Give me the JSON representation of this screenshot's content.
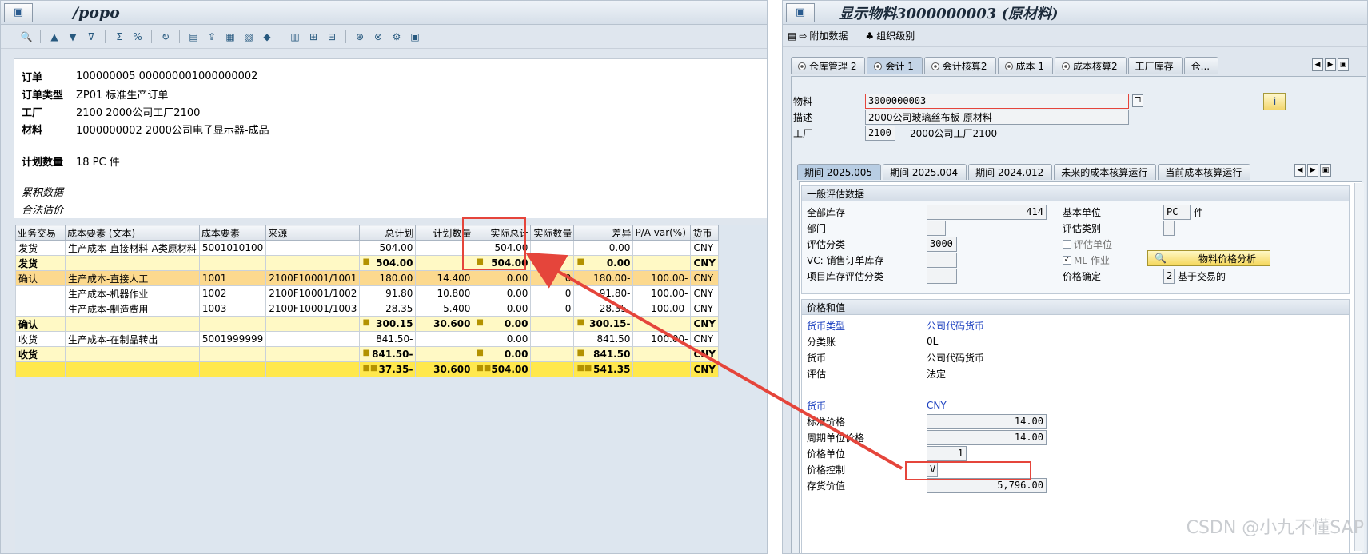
{
  "left": {
    "title": "/popo",
    "header": {
      "rows": [
        {
          "label": "订单",
          "value": "100000005 000000001000000002"
        },
        {
          "label": "订单类型",
          "value": "ZP01 标准生产订单"
        },
        {
          "label": "工厂",
          "value": "2100 2000公司工厂2100"
        },
        {
          "label": "材料",
          "value": "1000000002 2000公司电子显示器-成品"
        }
      ],
      "plan_label": "计划数量",
      "plan_value": "18 PC 件",
      "cum_label": "累积数据",
      "est_label": "合法估价"
    },
    "grid": {
      "columns": [
        "业务交易",
        "成本要素 (文本)",
        "成本要素",
        "来源",
        "总计划",
        "计划数量",
        "实际总计",
        "实际数量",
        "差异",
        "P/A var(%)",
        "货币"
      ],
      "rows": [
        {
          "type": "normal",
          "c": [
            "发货",
            "生产成本-直接材料-A类原材料",
            "5001010100",
            "",
            "504.00",
            "",
            "504.00",
            "",
            "0.00",
            "",
            "CNY"
          ]
        },
        {
          "type": "sub",
          "c": [
            "发货",
            "",
            "",
            "",
            "504.00",
            "",
            "504.00",
            "",
            "0.00",
            "",
            "CNY"
          ]
        },
        {
          "type": "hl",
          "c": [
            "确认",
            "生产成本-直接人工",
            "1001",
            "2100F10001/1001",
            "180.00",
            "14.400",
            "0.00",
            "0",
            "180.00-",
            "100.00-",
            "CNY"
          ]
        },
        {
          "type": "normal",
          "c": [
            "",
            "生产成本-机器作业",
            "1002",
            "2100F10001/1002",
            "91.80",
            "10.800",
            "0.00",
            "0",
            "91.80-",
            "100.00-",
            "CNY"
          ]
        },
        {
          "type": "normal",
          "c": [
            "",
            "生产成本-制造费用",
            "1003",
            "2100F10001/1003",
            "28.35",
            "5.400",
            "0.00",
            "0",
            "28.35-",
            "100.00-",
            "CNY"
          ]
        },
        {
          "type": "sub",
          "c": [
            "确认",
            "",
            "",
            "",
            "300.15",
            "30.600",
            "0.00",
            "",
            "300.15-",
            "",
            "CNY"
          ]
        },
        {
          "type": "normal",
          "c": [
            "收货",
            "生产成本-在制品转出",
            "5001999999",
            "",
            "841.50-",
            "",
            "0.00",
            "",
            "841.50",
            "100.00-",
            "CNY"
          ]
        },
        {
          "type": "sub",
          "c": [
            "收货",
            "",
            "",
            "",
            "841.50-",
            "",
            "0.00",
            "",
            "841.50",
            "",
            "CNY"
          ]
        },
        {
          "type": "tot",
          "c": [
            "",
            "",
            "",
            "",
            "37.35-",
            "30.600",
            "504.00",
            "",
            "541.35",
            "",
            "CNY"
          ]
        }
      ]
    }
  },
  "right": {
    "title": "显示物料3000000003 (原材料)",
    "toolbar": {
      "extra": "附加数据",
      "org": "组织级别"
    },
    "tabs": [
      "仓库管理 2",
      "会计 1",
      "会计核算2",
      "成本 1",
      "成本核算2",
      "工厂库存",
      "仓..."
    ],
    "fields": {
      "material_label": "物料",
      "material": "3000000003",
      "desc_label": "描述",
      "desc": "2000公司玻璃丝布板-原材料",
      "plant_label": "工厂",
      "plant": "2100",
      "plant_name": "2000公司工厂2100"
    },
    "subtabs": [
      "期间 2025.005",
      "期间 2025.004",
      "期间 2024.012",
      "未来的成本核算运行",
      "当前成本核算运行"
    ],
    "general": {
      "title": "一般评估数据",
      "total_stock_label": "全部库存",
      "total_stock": "414",
      "base_unit_label": "基本单位",
      "base_unit": "PC",
      "base_unit_text": "件",
      "dept_label": "部门",
      "val_cat_label": "评估类别",
      "val_class_label": "评估分类",
      "val_class": "3000",
      "val_unit_label": "评估单位",
      "vc_label": "VC: 销售订单库存",
      "ml_label": "ML 作业",
      "proj_label": "项目库存评估分类",
      "price_det_label": "价格确定",
      "price_det": "2",
      "price_det_text": "基于交易的",
      "analysis_btn": "物料价格分析"
    },
    "prices": {
      "title": "价格和值",
      "currency_type_label": "货币类型",
      "currency_type": "公司代码货币",
      "ledger_label": "分类账",
      "ledger": "0L",
      "currency_label": "货币",
      "currency_val": "公司代码货币",
      "valuation_label": "评估",
      "valuation": "法定",
      "cur_label": "货币",
      "cur": "CNY",
      "std_label": "标准价格",
      "std": "14.00",
      "per_label": "周期单位价格",
      "per": "14.00",
      "unit_label": "价格单位",
      "unit": "1",
      "ctrl_label": "价格控制",
      "ctrl": "V",
      "inv_label": "存货价值",
      "inv": "5,796.00"
    },
    "watermark": "CSDN @小九不懂SAP"
  },
  "colors": {
    "highlight_red": "#e5453b",
    "subtotal": "#fff9c5",
    "total": "#ffe84d",
    "selected_row": "#fcd98e"
  }
}
